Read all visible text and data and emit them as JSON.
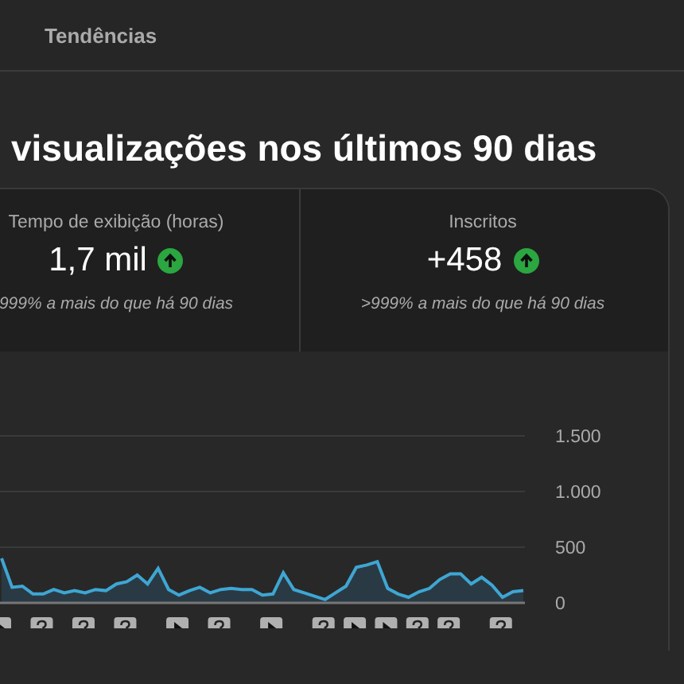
{
  "tabs": [
    {
      "label": "Tendências"
    }
  ],
  "title": "visualizações nos últimos 90 dias",
  "metrics": [
    {
      "label": "Tempo de exibição (horas)",
      "value": "1,7 mil",
      "rising": true,
      "comparison": "999% a mais do que há 90 dias"
    },
    {
      "label": "Inscritos",
      "value": "+458",
      "rising": true,
      "comparison": ">999% a mais do que há 90 dias"
    }
  ],
  "chart": {
    "chart_data": {
      "type": "area",
      "values": [
        400,
        140,
        150,
        80,
        80,
        120,
        90,
        110,
        90,
        120,
        110,
        170,
        190,
        250,
        170,
        310,
        120,
        70,
        110,
        140,
        90,
        120,
        130,
        120,
        120,
        70,
        80,
        270,
        120,
        90,
        60,
        30,
        90,
        150,
        320,
        340,
        370,
        130,
        80,
        50,
        100,
        130,
        210,
        260,
        260,
        170,
        230,
        160,
        50,
        100,
        110
      ],
      "ylim": [
        0,
        1500
      ],
      "yticks": [
        {
          "value": 0,
          "label": "0"
        },
        {
          "value": 500,
          "label": "500"
        },
        {
          "value": 1000,
          "label": "1.000"
        },
        {
          "value": 1500,
          "label": "1.500"
        }
      ]
    },
    "markers": [
      {
        "kind": "play"
      },
      {
        "kind": "question"
      },
      {
        "kind": "question"
      },
      {
        "kind": "question"
      },
      {
        "kind": "play"
      },
      {
        "kind": "question"
      },
      {
        "kind": "play"
      },
      {
        "kind": "question"
      },
      {
        "kind": "play"
      },
      {
        "kind": "play"
      },
      {
        "kind": "question"
      },
      {
        "kind": "question"
      },
      {
        "kind": "question"
      }
    ]
  }
}
